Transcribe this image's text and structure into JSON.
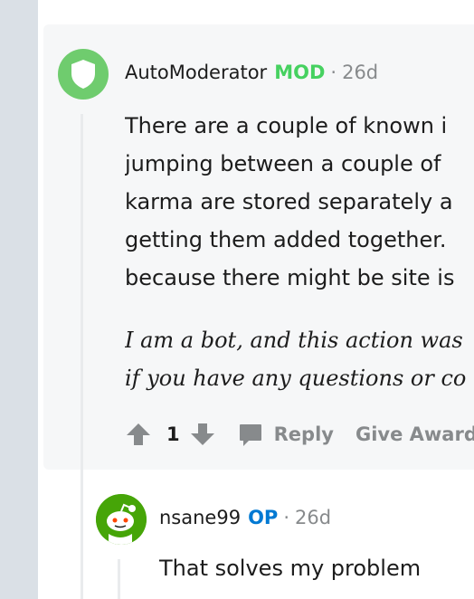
{
  "comment": {
    "author": "AutoModerator",
    "badge": "MOD",
    "separator": "·",
    "time": "26d",
    "body_lines": [
      "There are a couple of known i",
      "jumping between a couple of",
      "karma are stored separately a",
      "getting them added together.",
      "because there might be site is"
    ],
    "bot_lines": [
      "I am a bot, and this action was",
      "if you have any questions or co"
    ],
    "score": "1",
    "reply_label": "Reply",
    "award_label": "Give Award"
  },
  "reply": {
    "author": "nsane99",
    "badge": "OP",
    "separator": "·",
    "time": "26d",
    "body": "That solves my problem"
  },
  "colors": {
    "mod_badge": "#46d160",
    "op_badge": "#0079d3",
    "meta_gray": "#878a8c",
    "card_bg": "#f6f7f8",
    "gutter": "#dae0e6"
  },
  "icons": {
    "mod_avatar": "shield-icon",
    "upvote": "upvote-arrow-icon",
    "downvote": "downvote-arrow-icon",
    "reply": "speech-bubble-icon"
  }
}
